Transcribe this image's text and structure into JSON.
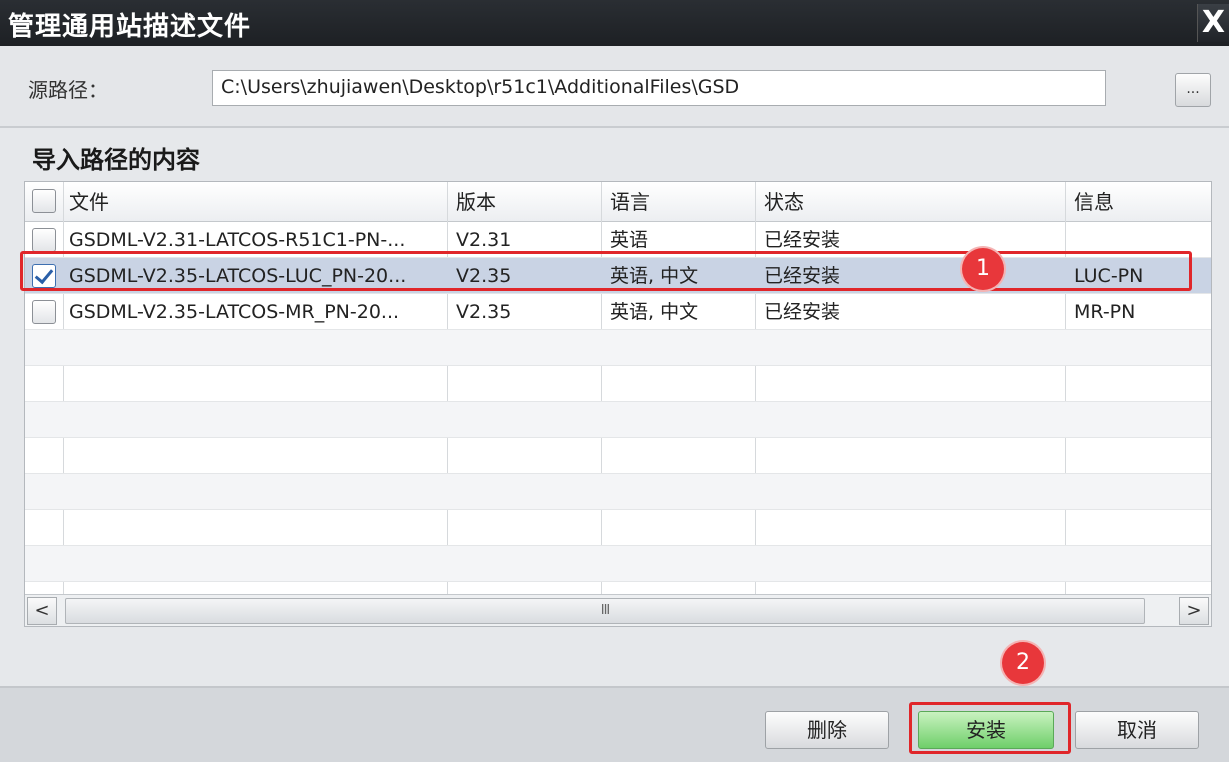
{
  "window": {
    "title": "管理通用站描述文件",
    "close_label": "X"
  },
  "source": {
    "label": "源路径：",
    "value": "C:\\Users\\zhujiawen\\Desktop\\r51c1\\AdditionalFiles\\GSD",
    "browse_label": "..."
  },
  "section_title": "导入路径的内容",
  "table": {
    "headers": [
      "文件",
      "版本",
      "语言",
      "状态",
      "信息"
    ],
    "rows": [
      {
        "checked": false,
        "file": "GSDML-V2.31-LATCOS-R51C1-PN-...",
        "version": "V2.31",
        "language": "英语",
        "status": "已经安装",
        "info": ""
      },
      {
        "checked": true,
        "file": "GSDML-V2.35-LATCOS-LUC_PN-20...",
        "version": "V2.35",
        "language": "英语, 中文",
        "status": "已经安装",
        "info": "LUC-PN"
      },
      {
        "checked": false,
        "file": "GSDML-V2.35-LATCOS-MR_PN-20...",
        "version": "V2.35",
        "language": "英语, 中文",
        "status": "已经安装",
        "info": "MR-PN"
      }
    ]
  },
  "scrollbar": {
    "left_arrow": "<",
    "right_arrow": ">",
    "thumb_grip": "III"
  },
  "buttons": {
    "delete": "删除",
    "install": "安装",
    "cancel": "取消"
  },
  "annotations": {
    "badge_1": "1",
    "badge_2": "2"
  },
  "colors": {
    "highlight": "#e0262a",
    "selected_row": "#c9d3e4",
    "install_button": "#6fcf6a"
  }
}
